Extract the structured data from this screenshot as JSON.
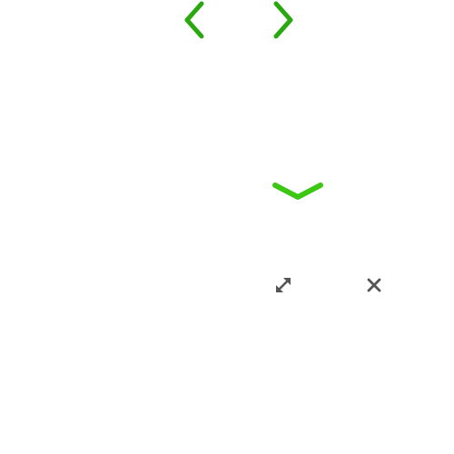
{
  "colors": {
    "nav_green": "#29a80f",
    "collapse_green": "#3cc812",
    "toolbar_gray": "#555555",
    "background": "#ffffff"
  },
  "icons": {
    "prev": "chevron-left-icon",
    "next": "chevron-right-icon",
    "collapse": "chevron-down-icon",
    "expand": "expand-arrows-icon",
    "close": "close-icon"
  }
}
